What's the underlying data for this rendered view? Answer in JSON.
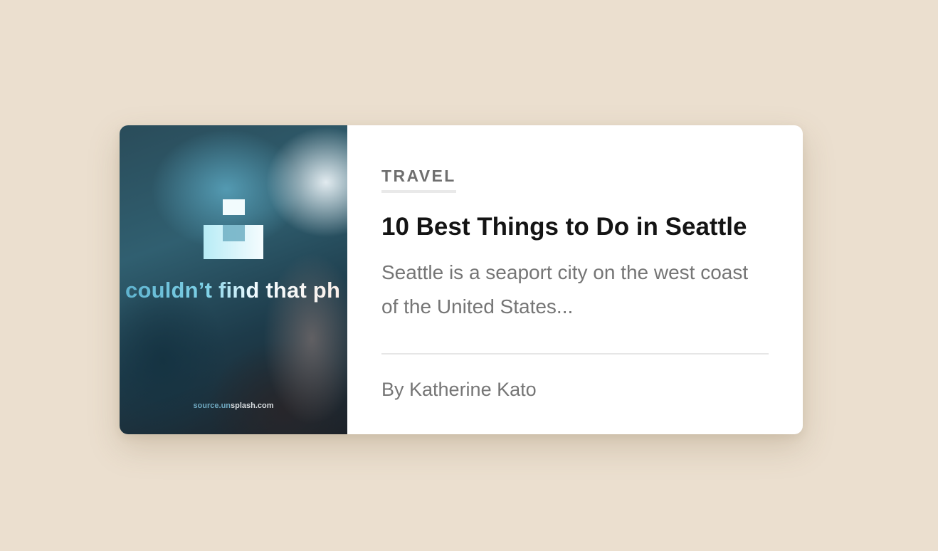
{
  "card": {
    "image": {
      "placeholder_text": "couldn’t find that ph",
      "source_prefix": "source.un",
      "source_suffix": "splash.com",
      "logo_icon": "unsplash-logo-icon"
    },
    "category": "TRAVEL",
    "title": "10 Best Things to Do in Seattle",
    "excerpt": "Seattle is a seaport city on the west coast of the United States...",
    "author": "By Katherine Kato"
  },
  "colors": {
    "background": "#ebdfcf",
    "card": "#ffffff",
    "title": "#141414",
    "muted": "#757575"
  }
}
